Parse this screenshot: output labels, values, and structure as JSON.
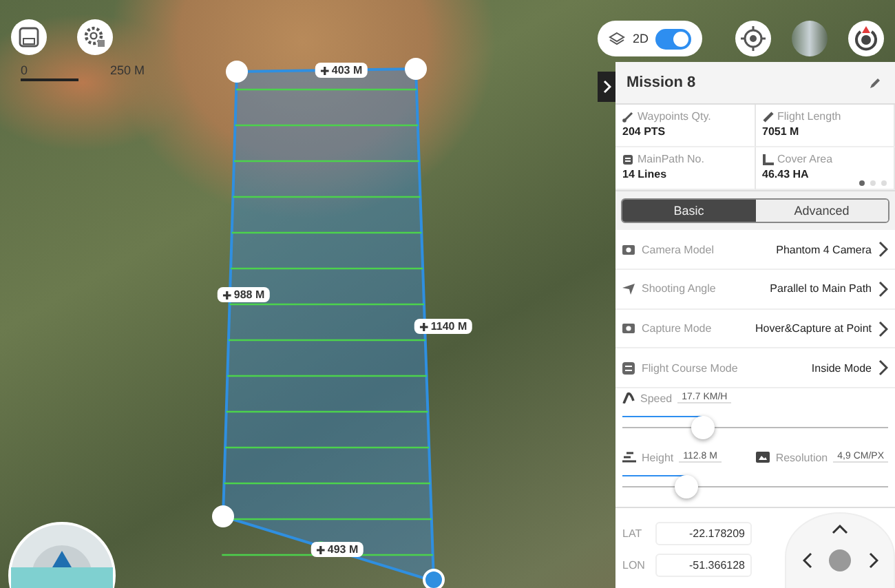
{
  "map": {
    "scale_labels": [
      "0",
      "250 M"
    ],
    "distance_labels": [
      {
        "text": "403 M"
      },
      {
        "text": "988 M"
      },
      {
        "text": "1140 M"
      },
      {
        "text": "493 M"
      }
    ],
    "view_toggle": {
      "label": "2D",
      "on": true
    }
  },
  "panel": {
    "title": "Mission 8",
    "stats": [
      {
        "label": "Waypoints Qty.",
        "value": "204 PTS",
        "kind": "waypoints"
      },
      {
        "label": "Flight Length",
        "value": "7051 M",
        "kind": "length"
      },
      {
        "label": "MainPath No.",
        "value": "14 Lines",
        "kind": "path"
      },
      {
        "label": "Cover Area",
        "value": "46.43 HA",
        "kind": "area"
      }
    ],
    "pages": [
      {
        "selected": true
      },
      {
        "selected": false
      },
      {
        "selected": false
      }
    ],
    "tabs": [
      {
        "label": "Basic",
        "selected": true
      },
      {
        "label": "Advanced",
        "selected": false
      }
    ],
    "settings": [
      {
        "label": "Camera Model",
        "value": "Phantom 4 Camera",
        "kind": "camera"
      },
      {
        "label": "Shooting Angle",
        "value": "Parallel to Main Path",
        "kind": "angle"
      },
      {
        "label": "Capture Mode",
        "value": "Hover&Capture at Point",
        "kind": "camera"
      },
      {
        "label": "Flight Course Mode",
        "value": "Inside Mode",
        "kind": "course"
      }
    ],
    "speed": {
      "label": "Speed",
      "value": "17.7 KM/H",
      "level": 0.3
    },
    "height": {
      "label": "Height",
      "value": "112.8 M",
      "level": 0.24,
      "resolution_label": "Resolution",
      "resolution_value": "4,9 CM/PX"
    },
    "lat": {
      "label": "LAT",
      "value": "-22.178209"
    },
    "lon": {
      "label": "LON",
      "value": "-51.366128"
    }
  }
}
